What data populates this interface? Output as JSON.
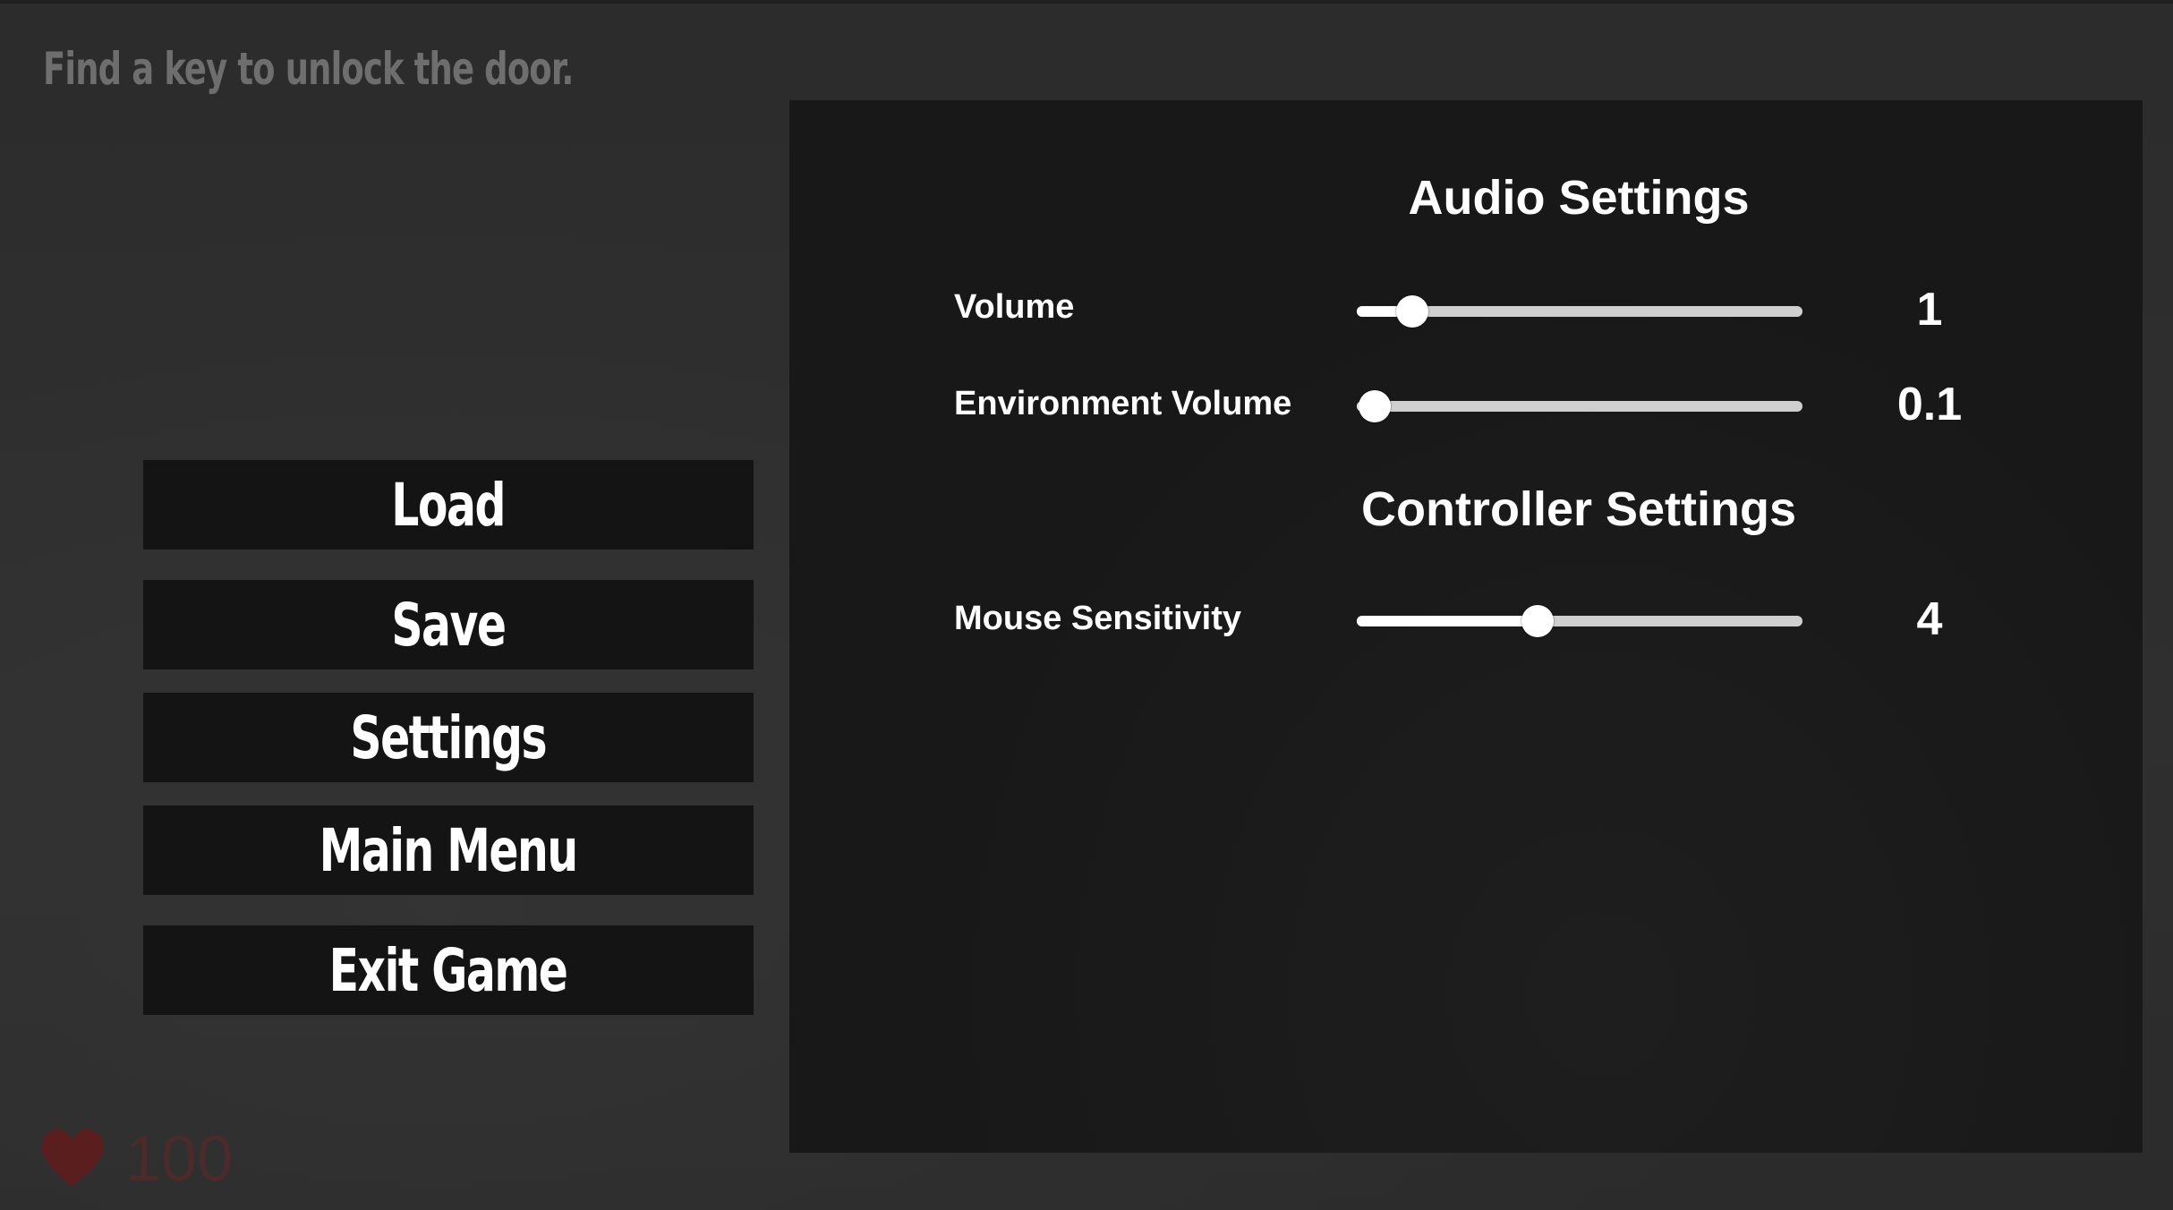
{
  "hud": {
    "objective": "Find a key to unlock the door.",
    "health_value": "100",
    "health_icon": "heart-icon",
    "health_color": "#5a1e1e"
  },
  "pause_menu": {
    "buttons": [
      {
        "label": "Load"
      },
      {
        "label": "Save"
      },
      {
        "label": "Settings"
      },
      {
        "label": "Main Menu"
      },
      {
        "label": "Exit Game"
      }
    ]
  },
  "settings": {
    "audio_title": "Audio Settings",
    "controller_title": "Controller Settings",
    "volume": {
      "label": "Volume",
      "value": "1",
      "fraction": 0.125
    },
    "environment_volume": {
      "label": "Environment Volume",
      "value": "0.1",
      "fraction": 0.04
    },
    "mouse_sensitivity": {
      "label": "Mouse Sensitivity",
      "value": "4",
      "fraction": 0.405
    }
  },
  "colors": {
    "background": "#2d2d2d",
    "panel": "#181818",
    "button": "#141414",
    "text": "#ffffff",
    "objective_text": "#6e6e6e"
  }
}
